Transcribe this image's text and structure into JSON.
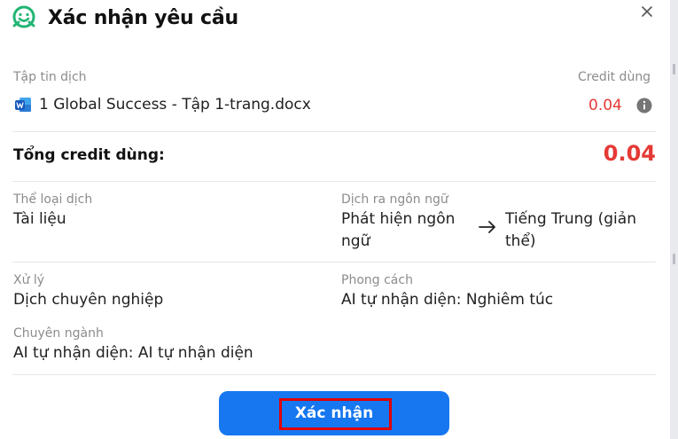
{
  "dialog": {
    "title": "Xác nhận yêu cầu"
  },
  "file_section": {
    "file_label": "Tập tin dịch",
    "credit_label": "Credit dùng",
    "file_name": "1 Global Success - Tập 1-trang.docx",
    "file_credit": "0.04"
  },
  "total": {
    "label": "Tổng credit dùng:",
    "value": "0.04"
  },
  "details": {
    "category_label": "Thể loại dịch",
    "category_value": "Tài liệu",
    "language_label": "Dịch ra ngôn ngữ",
    "source_line1": "Phát hiện ngôn",
    "source_line2": "ngữ",
    "target_line1": "Tiếng Trung (giản",
    "target_line2": "thể)",
    "processing_label": "Xử lý",
    "processing_value": "Dịch chuyên nghiệp",
    "style_label": "Phong cách",
    "style_value": "AI tự nhận diện: Nghiêm túc",
    "field_label": "Chuyên ngành",
    "field_value": "AI tự nhận diện: AI tự nhận diện"
  },
  "confirm_button": {
    "label": "Xác nhận"
  },
  "colors": {
    "accent": "#1677f0",
    "credit": "#e53935",
    "brand": "#22b573",
    "highlight": "#e00000"
  },
  "icons": {
    "logo": "smiley-face-logo-icon",
    "close": "close-icon",
    "file": "word-document-icon",
    "info": "info-icon",
    "arrow": "arrow-right-icon"
  }
}
